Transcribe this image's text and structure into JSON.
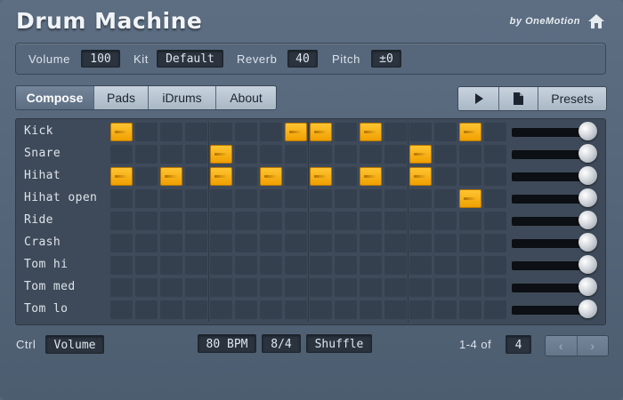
{
  "header": {
    "title": "Drum Machine",
    "byline": "by OneMotion",
    "home_icon": "home-icon"
  },
  "params": {
    "volume_label": "Volume",
    "volume_value": "100",
    "kit_label": "Kit",
    "kit_value": "Default",
    "reverb_label": "Reverb",
    "reverb_value": "40",
    "pitch_label": "Pitch",
    "pitch_value": "±0"
  },
  "tabs": [
    {
      "label": "Compose",
      "active": true
    },
    {
      "label": "Pads"
    },
    {
      "label": "iDrums"
    },
    {
      "label": "About"
    }
  ],
  "toolbar": {
    "play_icon": "play-icon",
    "file_icon": "file-icon",
    "presets_label": "Presets"
  },
  "sequencer": {
    "steps": 16,
    "rows": [
      {
        "name": "Kick",
        "steps": [
          0,
          7,
          8,
          10,
          14
        ],
        "level": 1.0
      },
      {
        "name": "Snare",
        "steps": [
          4,
          12
        ],
        "level": 1.0
      },
      {
        "name": "Hihat",
        "steps": [
          0,
          2,
          4,
          6,
          8,
          10,
          12
        ],
        "level": 1.0
      },
      {
        "name": "Hihat open",
        "steps": [
          14
        ],
        "level": 1.0
      },
      {
        "name": "Ride",
        "steps": [],
        "level": 1.0
      },
      {
        "name": "Crash",
        "steps": [],
        "level": 1.0
      },
      {
        "name": "Tom hi",
        "steps": [],
        "level": 1.0
      },
      {
        "name": "Tom med",
        "steps": [],
        "level": 1.0
      },
      {
        "name": "Tom lo",
        "steps": [],
        "level": 1.0
      }
    ]
  },
  "footer": {
    "ctrl_label": "Ctrl",
    "ctrl_value": "Volume",
    "bpm": "80 BPM",
    "meter": "8/4",
    "shuffle_label": "Shuffle",
    "page_range": "1-4 of",
    "page_total": "4",
    "prev": "‹",
    "next": "›"
  },
  "colors": {
    "step_on": "#f5a800",
    "background": "#56667a"
  }
}
